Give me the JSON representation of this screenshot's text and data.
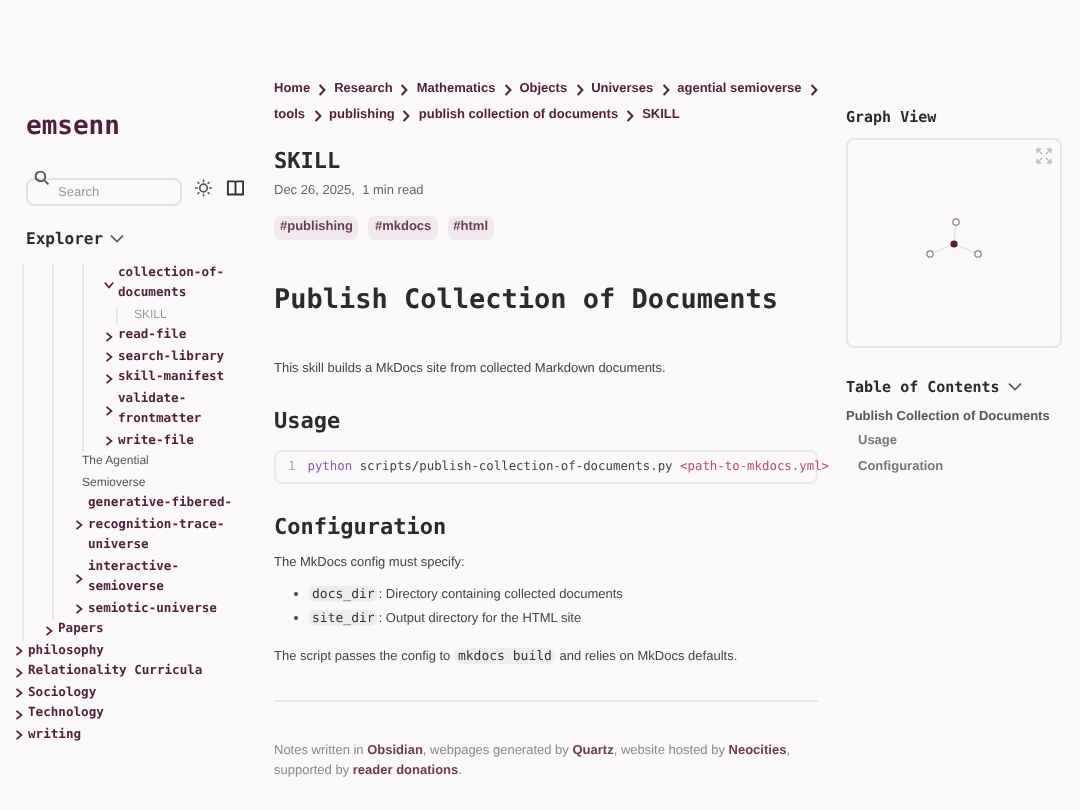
{
  "site_title": "emsenn",
  "search": {
    "placeholder": "Search"
  },
  "explorer": {
    "title": "Explorer",
    "items": [
      {
        "kind": "group",
        "children": [
          {
            "kind": "group",
            "children": [
              {
                "kind": "group",
                "children": [
                  {
                    "kind": "folder",
                    "label": "collection-of-documents",
                    "expanded": true,
                    "children": [
                      {
                        "kind": "file",
                        "label": "SKILL",
                        "selected": true
                      }
                    ]
                  },
                  {
                    "kind": "folder",
                    "label": "read-file",
                    "expanded": false
                  },
                  {
                    "kind": "folder",
                    "label": "search-library",
                    "expanded": false
                  },
                  {
                    "kind": "folder",
                    "label": "skill-manifest",
                    "expanded": false
                  },
                  {
                    "kind": "folder",
                    "label": "validate-frontmatter",
                    "expanded": false
                  },
                  {
                    "kind": "folder",
                    "label": "write-file",
                    "expanded": false
                  }
                ]
              },
              {
                "kind": "file",
                "label": "The Agential Semioverse",
                "selected": false
              },
              {
                "kind": "folder",
                "label": "generative-fibered-recognition-trace-universe",
                "expanded": false
              },
              {
                "kind": "folder",
                "label": "interactive-semioverse",
                "expanded": false
              },
              {
                "kind": "folder",
                "label": "semiotic-universe",
                "expanded": false
              }
            ]
          },
          {
            "kind": "folder",
            "label": "Papers",
            "expanded": false
          }
        ]
      },
      {
        "kind": "folder",
        "label": "philosophy",
        "expanded": false
      },
      {
        "kind": "folder",
        "label": "Relationality Curricula",
        "expanded": false
      },
      {
        "kind": "folder",
        "label": "Sociology",
        "expanded": false
      },
      {
        "kind": "folder",
        "label": "Technology",
        "expanded": false
      },
      {
        "kind": "folder",
        "label": "writing",
        "expanded": false
      }
    ]
  },
  "breadcrumbs": [
    "Home",
    "Research",
    "Mathematics",
    "Objects",
    "Universes",
    "agential semioverse",
    "tools",
    "publishing",
    "publish collection of documents",
    "SKILL"
  ],
  "page": {
    "title": "SKILL",
    "meta": "Dec 26, 2025,  1 min read",
    "tags": [
      "#publishing",
      "#mkdocs",
      "#html"
    ],
    "heading": "Publish Collection of Documents",
    "blocks": [
      {
        "kind": "paragraph",
        "parts": [
          {
            "kind": "text",
            "text": "This skill builds a MkDocs site from collected Markdown documents."
          }
        ]
      },
      {
        "kind": "heading",
        "text": "Usage"
      },
      {
        "kind": "code",
        "line_number": "1",
        "tokens": [
          {
            "kind": "keyword",
            "text": "python"
          },
          {
            "kind": "plain",
            "text": " scripts/publish-collection-of-documents.py "
          },
          {
            "kind": "string",
            "text": "<path-to-mkdocs.yml>"
          }
        ]
      },
      {
        "kind": "heading",
        "text": "Configuration"
      },
      {
        "kind": "paragraph",
        "parts": [
          {
            "kind": "text",
            "text": "The MkDocs config must specify:"
          }
        ]
      },
      {
        "kind": "list",
        "items": [
          [
            {
              "kind": "code",
              "text": "docs_dir"
            },
            {
              "kind": "text",
              "text": ": Directory containing collected documents"
            }
          ],
          [
            {
              "kind": "code",
              "text": "site_dir"
            },
            {
              "kind": "text",
              "text": ": Output directory for the HTML site"
            }
          ]
        ]
      },
      {
        "kind": "paragraph",
        "parts": [
          {
            "kind": "text",
            "text": "The script passes the config to "
          },
          {
            "kind": "code",
            "text": "mkdocs build"
          },
          {
            "kind": "text",
            "text": " and relies on MkDocs defaults."
          }
        ]
      }
    ]
  },
  "footer": [
    {
      "kind": "text",
      "text": "Notes written in "
    },
    {
      "kind": "link",
      "text": "Obsidian"
    },
    {
      "kind": "text",
      "text": ", webpages generated by "
    },
    {
      "kind": "link",
      "text": "Quartz"
    },
    {
      "kind": "text",
      "text": ", website hosted by "
    },
    {
      "kind": "link",
      "text": "Neocities"
    },
    {
      "kind": "text",
      "text": ", supported by "
    },
    {
      "kind": "link",
      "text": "reader donations"
    },
    {
      "kind": "text",
      "text": "."
    }
  ],
  "graph": {
    "title": "Graph View"
  },
  "toc": {
    "title": "Table of Contents",
    "expanded": true,
    "items": [
      {
        "text": "Publish Collection of Documents",
        "kind": "top"
      },
      {
        "text": "Usage",
        "kind": "sub"
      },
      {
        "text": "Configuration",
        "kind": "sub"
      }
    ]
  }
}
